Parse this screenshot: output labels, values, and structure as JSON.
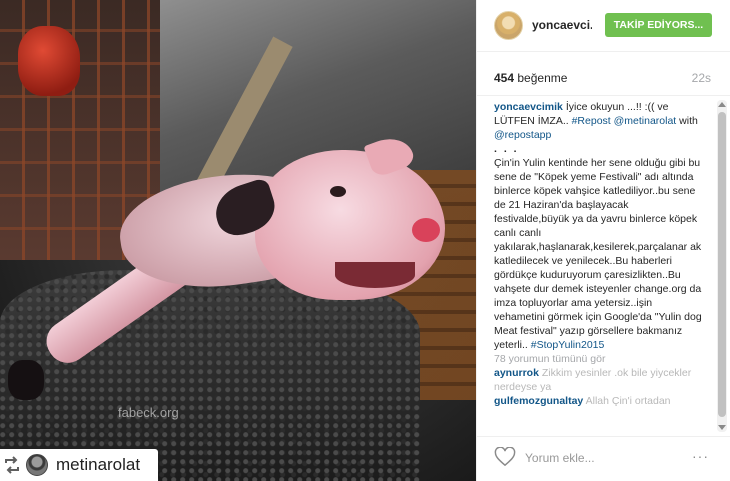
{
  "photo": {
    "watermark": "fabeck.org"
  },
  "repost_badge": {
    "icon": "repost-icon",
    "username": "metinarolat"
  },
  "header": {
    "username": "yoncaevcimik",
    "username_display": "yoncaevci...",
    "follow_label": "TAKİP EDİYORS..."
  },
  "stats": {
    "likes_count": "454",
    "likes_label": "beğenme",
    "time": "22s"
  },
  "caption": {
    "author": "yoncaevcimik",
    "line1": "İyice okuyun ...!! :(( ve LÜTFEN İMZA.. ",
    "tag_repost": "#Repost",
    "mention1": "@metinarolat",
    "with": "with",
    "mention2": "@repostapp",
    "dots": ". . .",
    "body": "Çin'in Yulin kentinde her sene olduğu gibi bu sene de \"Köpek yeme Festivali\" adı altında binlerce köpek vahşice katlediliyor..bu sene de 21 Haziran'da başlayacak festivalde,büyük ya da yavru binlerce köpek canlı canlı yakılarak,haşlanarak,kesilerek,parçalanar ak katledilecek ve yenilecek..Bu haberleri gördükçe kuduruyorum çaresizlikten..Bu vahşete dur demek isteyenler change.org da imza topluyorlar ama yetersiz..işin vehametini görmek için Google'da \"Yulin dog Meat festival\" yazıp görsellere bakmanız yeterli.. ",
    "hashtag": "#StopYulin2015"
  },
  "view_all_comments": "78 yorumun tümünü gör",
  "comments": [
    {
      "user": "aynurrok",
      "text": "Zikkim yesinler .ok bile yiycekler nerdeyse ya"
    },
    {
      "user": "gulfemozgunaltay",
      "text": "Allah Çin'i ortadan"
    }
  ],
  "footer": {
    "comment_placeholder": "Yorum ekle...",
    "more_label": "···",
    "heart_icon": "heart-icon"
  },
  "colors": {
    "follow_button": "#70c050",
    "link": "#125688",
    "muted": "#a5a7aa"
  }
}
